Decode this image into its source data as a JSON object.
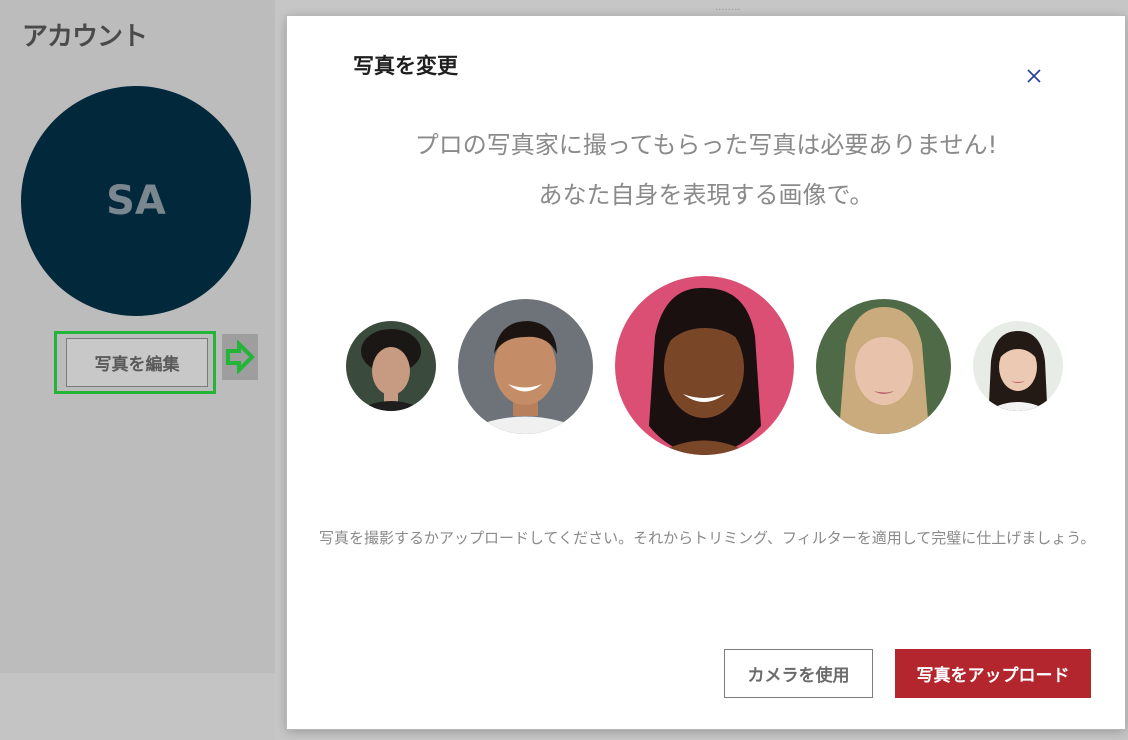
{
  "background": {
    "account_title": "アカウント",
    "avatar_initials": "SA",
    "edit_photo_label": "写真を編集",
    "top_partial_text": "........",
    "colors": {
      "avatar_bg": "#02283b",
      "highlight": "#22b537"
    }
  },
  "modal": {
    "title": "写真を変更",
    "close_icon": "close-icon",
    "headline_line1": "プロの写真家に撮ってもらった写真は必要ありません!",
    "headline_line2": "あなた自身を表現する画像で。",
    "sample_photos": [
      "sample-face-1",
      "sample-face-2",
      "sample-face-3",
      "sample-face-4",
      "sample-face-5"
    ],
    "description": "写真を撮影するかアップロードしてください。それからトリミング、フィルターを適用して完璧に仕上げましょう。",
    "camera_button": "カメラを使用",
    "upload_button": "写真をアップロード",
    "colors": {
      "primary": "#b3262d",
      "close": "#2b3a9e"
    }
  }
}
